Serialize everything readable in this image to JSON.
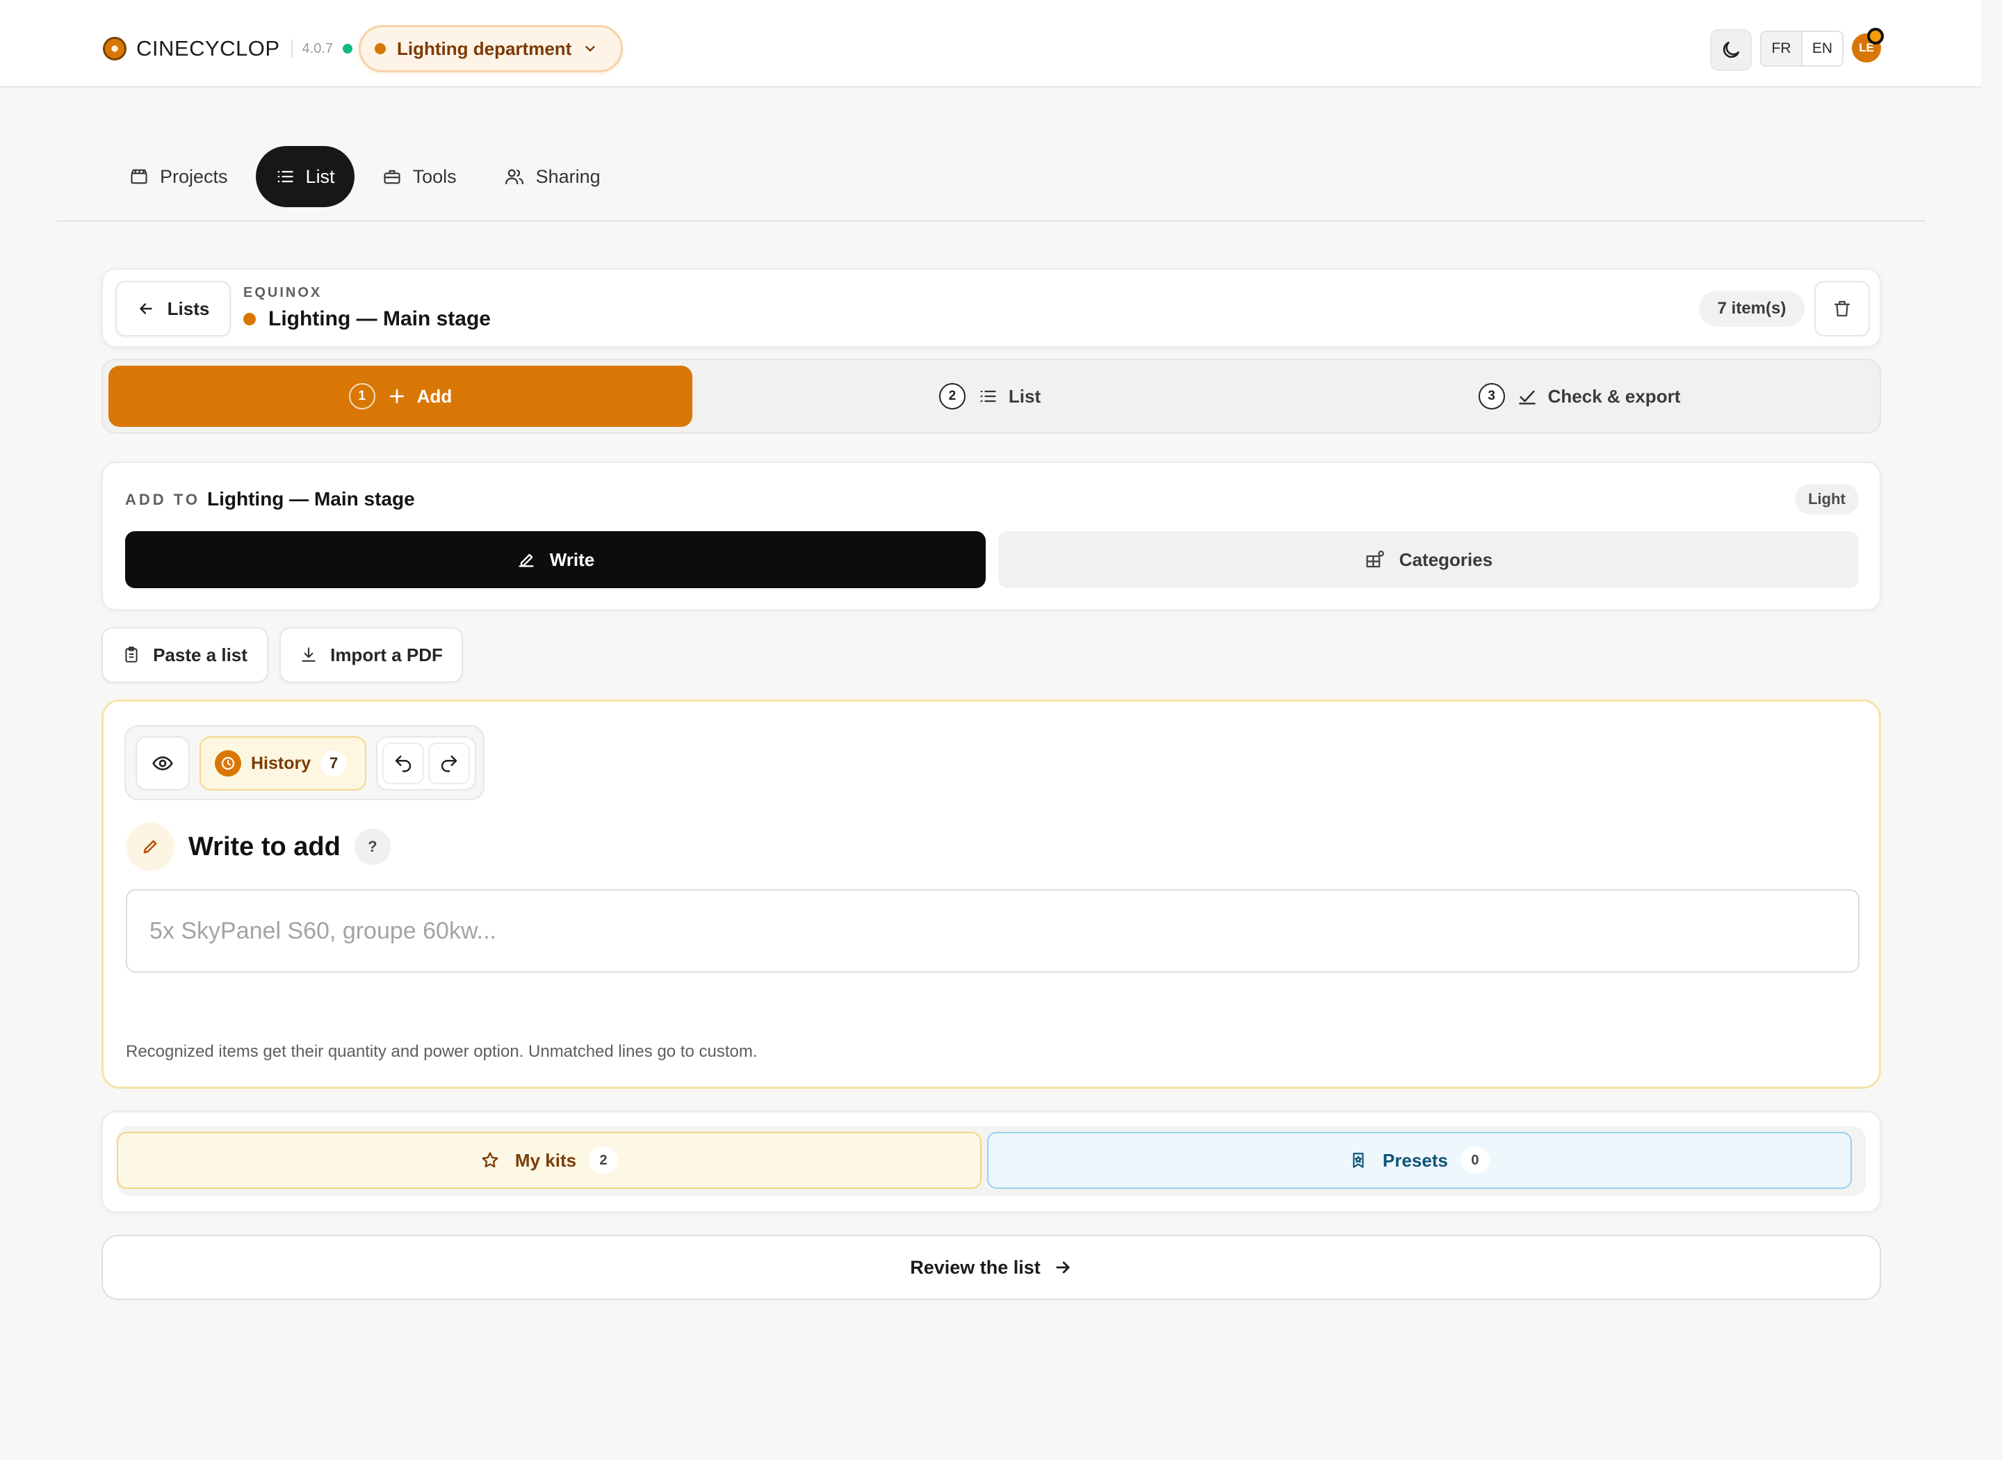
{
  "brand": {
    "name": "CINECYCLOP",
    "version": "4.0.7"
  },
  "department": {
    "label": "Lighting department"
  },
  "header": {
    "languages": [
      {
        "code": "FR",
        "active": true
      },
      {
        "code": "EN",
        "active": false
      }
    ],
    "avatar_initials": "LE"
  },
  "nav": {
    "tabs": [
      {
        "label": "Projects",
        "icon": "clapperboard-icon",
        "active": false
      },
      {
        "label": "List",
        "icon": "list-icon",
        "active": true
      },
      {
        "label": "Tools",
        "icon": "toolbox-icon",
        "active": false
      },
      {
        "label": "Sharing",
        "icon": "users-icon",
        "active": false
      }
    ]
  },
  "list": {
    "back_label": "Lists",
    "project": "EQUINOX",
    "name": "Lighting — Main stage",
    "item_count": "7 item(s)"
  },
  "stepper": {
    "steps": [
      {
        "num": "1",
        "label": "Add",
        "icon": "plus-icon",
        "active": true
      },
      {
        "num": "2",
        "label": "List",
        "icon": "list-icon",
        "active": false
      },
      {
        "num": "3",
        "label": "Check & export",
        "icon": "check-icon",
        "active": false
      }
    ]
  },
  "add_to": {
    "kicker": "ADD TO",
    "target": "Lighting — Main stage",
    "badge": "Light",
    "modes": [
      {
        "label": "Write",
        "icon": "pen-icon",
        "active": true
      },
      {
        "label": "Categories",
        "icon": "grid-icon",
        "active": false
      }
    ]
  },
  "actions": {
    "paste": "Paste a list",
    "pdf": "Import a PDF"
  },
  "write": {
    "history_label": "History",
    "history_count": "7",
    "title": "Write to add",
    "help": "?",
    "input_value": "",
    "placeholder": "5x SkyPanel S60, groupe 60kw...",
    "note": "Recognized items get their quantity and power option. Unmatched lines go to custom."
  },
  "kits": {
    "mine_label": "My kits",
    "mine_count": "2",
    "presets_label": "Presets",
    "presets_count": "0"
  },
  "review": {
    "label": "Review the list"
  },
  "colors": {
    "accent": "#d97706",
    "dark": "#0d0d0d",
    "status_ok": "#10b981",
    "preset_blue": "#0e5479"
  }
}
